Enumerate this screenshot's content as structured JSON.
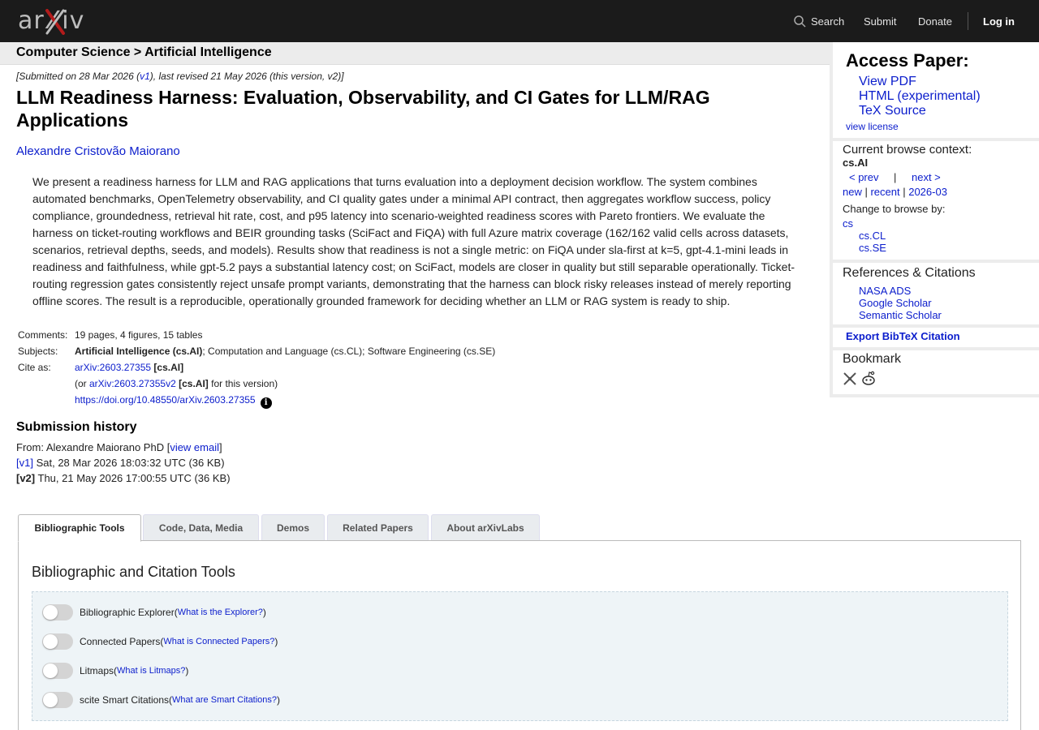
{
  "header": {
    "logo_text": "arXiv",
    "search_label": "Search",
    "submit_label": "Submit",
    "donate_label": "Donate",
    "login_label": "Log in"
  },
  "breadcrumb": "Computer Science > Artificial Intelligence",
  "paper": {
    "dateline": "[Submitted on 28 Mar 2026 (v1), last revised 21 May 2026 (this version, v2)]",
    "dateline_a": "[Submitted on 28 Mar 2026 (",
    "dateline_link": "v1",
    "dateline_b": "), last revised 21 May 2026 (this version, v2)]",
    "title": "LLM Readiness Harness: Evaluation, Observability, and CI Gates for LLM/RAG Applications",
    "author": "Alexandre Cristovão Maiorano",
    "abstract": "We present a readiness harness for LLM and RAG applications that turns evaluation into a deployment decision workflow. The system combines automated benchmarks, OpenTelemetry observability, and CI quality gates under a minimal API contract, then aggregates workflow success, policy compliance, groundedness, retrieval hit rate, cost, and p95 latency into scenario-weighted readiness scores with Pareto frontiers. We evaluate the harness on ticket-routing workflows and BEIR grounding tasks (SciFact and FiQA) with full Azure matrix coverage (162/162 valid cells across datasets, scenarios, retrieval depths, seeds, and models). Results show that readiness is not a single metric: on FiQA under sla-first at k=5, gpt-4.1-mini leads in readiness and faithfulness, while gpt-5.2 pays a substantial latency cost; on SciFact, models are closer in quality but still separable operationally. Ticket-routing regression gates consistently reject unsafe prompt variants, demonstrating that the harness can block risky releases instead of merely reporting offline scores. The result is a reproducible, operationally grounded framework for deciding whether an LLM or RAG system is ready to ship."
  },
  "meta": {
    "comments_key": "Comments:",
    "comments_val": "19 pages, 4 figures, 15 tables",
    "subjects_key": "Subjects:",
    "subjects_primary": "Artificial Intelligence (cs.AI)",
    "subjects_rest": "; Computation and Language (cs.CL); Software Engineering (cs.SE)",
    "cite_key": "Cite as:",
    "cite_id": "arXiv:2603.27355",
    "cite_cat": "[cs.AI]",
    "cite_or": "(or ",
    "cite_v2": "arXiv:2603.27355v2",
    "cite_v2_cat": "[cs.AI]",
    "cite_v2_tail": " for this version)",
    "doi": "https://doi.org/10.48550/arXiv.2603.27355"
  },
  "history": {
    "heading": "Submission history",
    "from_prefix": "From: Alexandre Maiorano PhD [",
    "view_email": "view email",
    "from_suffix": "]",
    "v1_label": "[v1]",
    "v1_text": " Sat, 28 Mar 2026 18:03:32 UTC (36 KB)",
    "v2_label": "[v2]",
    "v2_text": " Thu, 21 May 2026 17:00:55 UTC (36 KB)"
  },
  "tabs": [
    {
      "label": "Bibliographic Tools"
    },
    {
      "label": "Code, Data, Media"
    },
    {
      "label": "Demos"
    },
    {
      "label": "Related Papers"
    },
    {
      "label": "About arXivLabs"
    }
  ],
  "panel": {
    "heading": "Bibliographic and Citation Tools",
    "tools": [
      {
        "label": "Bibliographic Explorer",
        "open": " (",
        "help": "What is the Explorer?",
        "close": ")"
      },
      {
        "label": "Connected Papers",
        "open": " (",
        "help": "What is Connected Papers?",
        "close": ")"
      },
      {
        "label": "Litmaps",
        "open": " (",
        "help": "What is Litmaps?",
        "close": ")"
      },
      {
        "label": "scite Smart Citations",
        "open": " (",
        "help": "What are Smart Citations?",
        "close": ")"
      }
    ]
  },
  "sidebar": {
    "access_heading": "Access Paper:",
    "view_pdf": "View PDF",
    "html": "HTML (experimental)",
    "tex": "TeX Source",
    "license": "view license",
    "context_label": "Current browse context:",
    "context_value": "cs.AI",
    "prev": "< prev",
    "pipe": "|",
    "next": "next >",
    "new": "new",
    "recent": "recent",
    "month": "2026-03",
    "sep": " | ",
    "change_label": "Change to browse by:",
    "browse_cs": "cs",
    "browse_cl": "cs.CL",
    "browse_se": "cs.SE",
    "refs_heading": "References & Citations",
    "nasa": "NASA ADS",
    "google": "Google Scholar",
    "semantic": "Semantic Scholar",
    "bibtex": "Export BibTeX Citation",
    "bookmark": "Bookmark"
  },
  "colors": {
    "header_bg": "#1b1b1b",
    "logo_red": "#b31b1b",
    "link": "#0b1dcc"
  }
}
